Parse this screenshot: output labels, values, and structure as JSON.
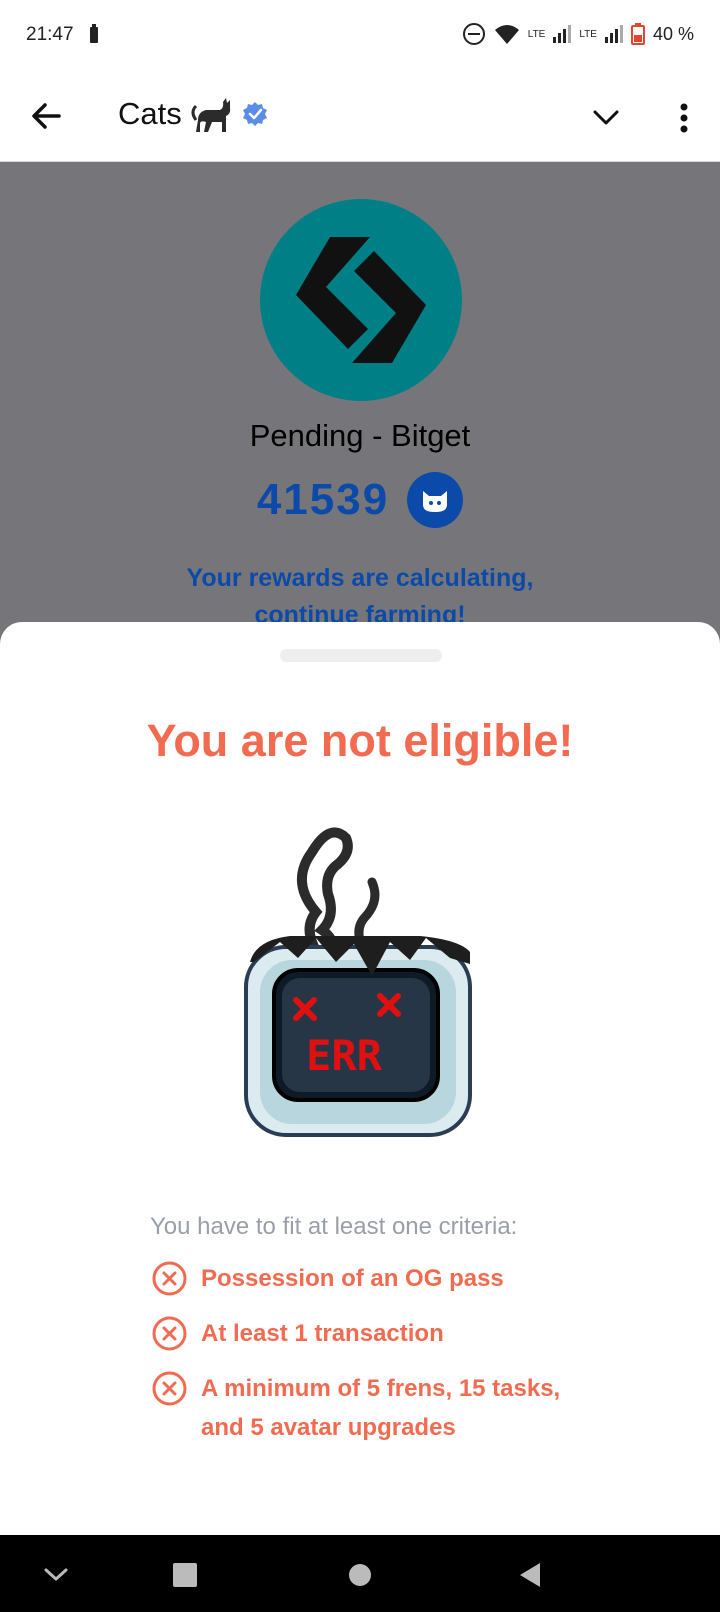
{
  "status_bar": {
    "time": "21:47",
    "battery_percent": "40 %",
    "network_labels": [
      "LTE",
      "LTE"
    ]
  },
  "app_bar": {
    "title": "Cats",
    "title_emoji": "cat-emoji",
    "verified_icon": "verified-badge-icon"
  },
  "webview": {
    "exchange_logo": "bitget-logo",
    "pending_title": "Pending - Bitget",
    "score": "41539",
    "rewards_text": "Your rewards are calculating, continue farming!"
  },
  "sheet": {
    "title": "You are not eligible!",
    "illustration": "err-monitor-illustration",
    "err_label": "ERR",
    "criteria_label": "You have to fit at least one criteria:",
    "criteria": [
      {
        "text": "Possession of an OG pass"
      },
      {
        "text": "At least 1 transaction"
      },
      {
        "text": "A minimum of 5 frens, 15 tasks, and 5 avatar upgrades"
      }
    ]
  },
  "colors": {
    "accent": "#f26b50",
    "score_blue": "#0b4aa8",
    "bitget_teal": "#017f86",
    "overlay_gray": "#76767a",
    "muted_text": "#9a9ea8"
  }
}
